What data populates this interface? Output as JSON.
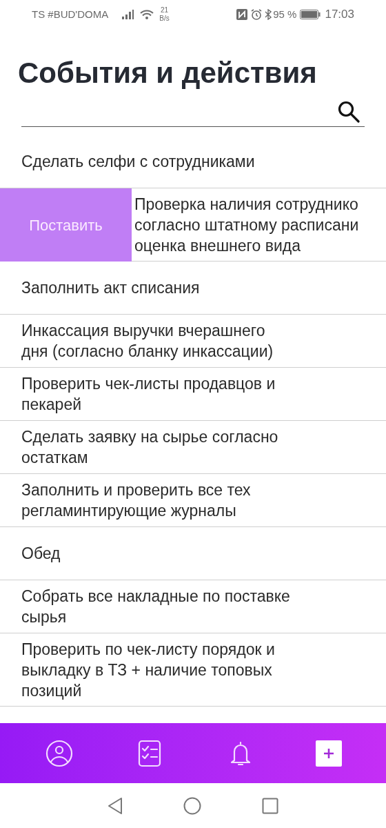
{
  "status_bar": {
    "carrier": "ТS #BUD'DOMA",
    "speed_value": "21",
    "speed_unit": "B/s",
    "battery": "95 %",
    "time": "17:03"
  },
  "title": "События и действия",
  "items": [
    {
      "kind": "plain",
      "lines": [
        "Сделать селфи с сотрудниками"
      ]
    },
    {
      "kind": "swiped",
      "action": "Поставить",
      "lines": [
        "Проверка наличия сотруднико",
        "согласно штатному расписани",
        "оценка внешнего вида"
      ]
    },
    {
      "kind": "plain",
      "lines": [
        "Заполнить акт списания"
      ]
    },
    {
      "kind": "plain",
      "lines": [
        "Инкассация выручки вчерашнего",
        "дня (согласно бланку инкассации)"
      ]
    },
    {
      "kind": "plain",
      "lines": [
        "Проверить чек-листы продавцов и",
        "пекарей"
      ]
    },
    {
      "kind": "plain",
      "lines": [
        "Сделать заявку на сырье согласно",
        "остаткам"
      ]
    },
    {
      "kind": "plain",
      "lines": [
        "Заполнить и проверить все тех",
        "регламинтирующие журналы"
      ]
    },
    {
      "kind": "plain",
      "lines": [
        "Обед"
      ]
    },
    {
      "kind": "plain",
      "lines": [
        "Собрать все накладные по поставке",
        "сырья"
      ]
    },
    {
      "kind": "plain",
      "lines": [
        "Проверить по чек-листу порядок и",
        "выкладку в ТЗ + наличие топовых",
        "позиций"
      ]
    }
  ],
  "nav": [
    {
      "kind": "profile"
    },
    {
      "kind": "checklist"
    },
    {
      "kind": "bell"
    },
    {
      "kind": "add"
    }
  ]
}
